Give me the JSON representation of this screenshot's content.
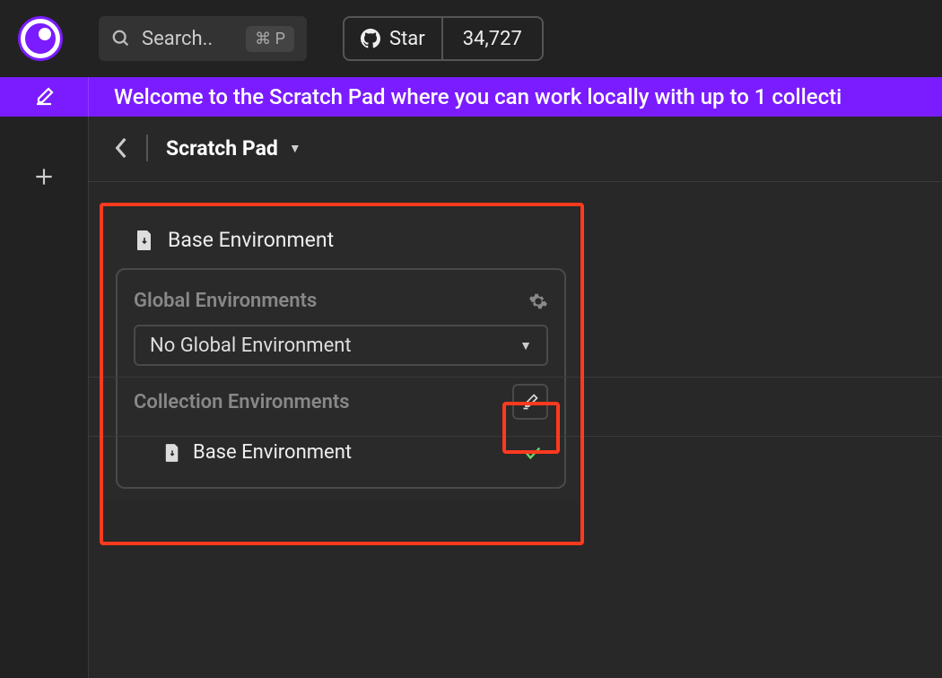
{
  "topbar": {
    "search_placeholder": "Search..",
    "kbd_hint": "⌘ P",
    "github_star_label": "Star",
    "github_count": "34,727"
  },
  "banner": {
    "text": "Welcome to the Scratch Pad where you can work locally with up to 1 collecti"
  },
  "breadcrumb": {
    "title": "Scratch Pad"
  },
  "dropdown": {
    "base_env_label": "Base Environment",
    "global_section_title": "Global Environments",
    "global_select_value": "No Global Environment",
    "collection_section_title": "Collection Environments",
    "collection_item_label": "Base Environment"
  }
}
